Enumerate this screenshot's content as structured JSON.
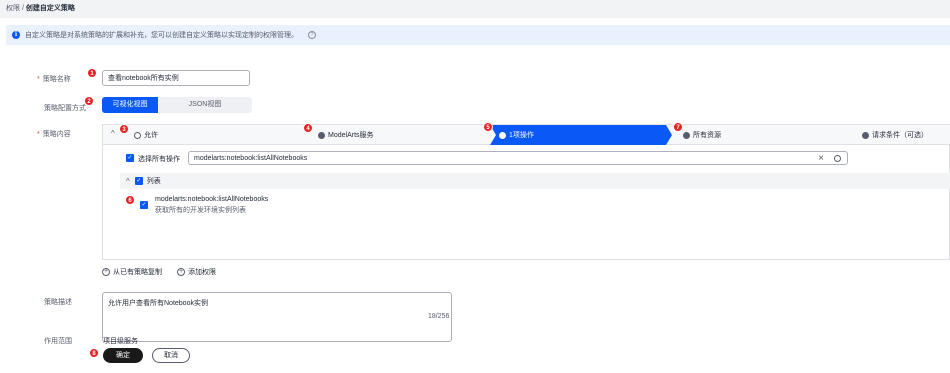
{
  "breadcrumb": {
    "parent": "权限",
    "separator": "/",
    "current": "创建自定义策略"
  },
  "info": {
    "icon": "info-icon",
    "text": "自定义策略是对系统策略的扩展和补充，您可以创建自定义策略以实现定制的权限管理。",
    "help_icon": "help-icon"
  },
  "form": {
    "name_label": "策略名称",
    "name_value": "查看notebook所有实例",
    "mode_label": "策略配置方式",
    "mode_visual": "可视化视图",
    "mode_json": "JSON视图",
    "content_label": "策略内容",
    "desc_label": "策略描述",
    "desc_value": "允许用户查看所有Notebook实例",
    "desc_count": "18/256",
    "scope_label": "作用范围",
    "scope_value": "项目级服务"
  },
  "steps": {
    "allow": "允许",
    "service": "ModelArts服务",
    "action": "1项操作",
    "resource": "所有资源",
    "condition": "请求条件（可选）"
  },
  "actions": {
    "select_all": "选择所有操作",
    "search_value": "modelarts:notebook:listAllNotebooks",
    "clear_icon": "×",
    "list_header": "列表",
    "item_name": "modelarts:notebook:listAllNotebooks",
    "item_desc": "获取所有的开发环境实例列表"
  },
  "links": {
    "copy_existing": "从已有策略复制",
    "add_permission": "添加权限"
  },
  "buttons": {
    "ok": "确定",
    "cancel": "取消"
  },
  "badges": [
    "1",
    "2",
    "3",
    "4",
    "5",
    "6",
    "7",
    "8"
  ],
  "colors": {
    "primary": "#0a59f7",
    "badge": "#e62222",
    "required": "#e73a3a"
  }
}
